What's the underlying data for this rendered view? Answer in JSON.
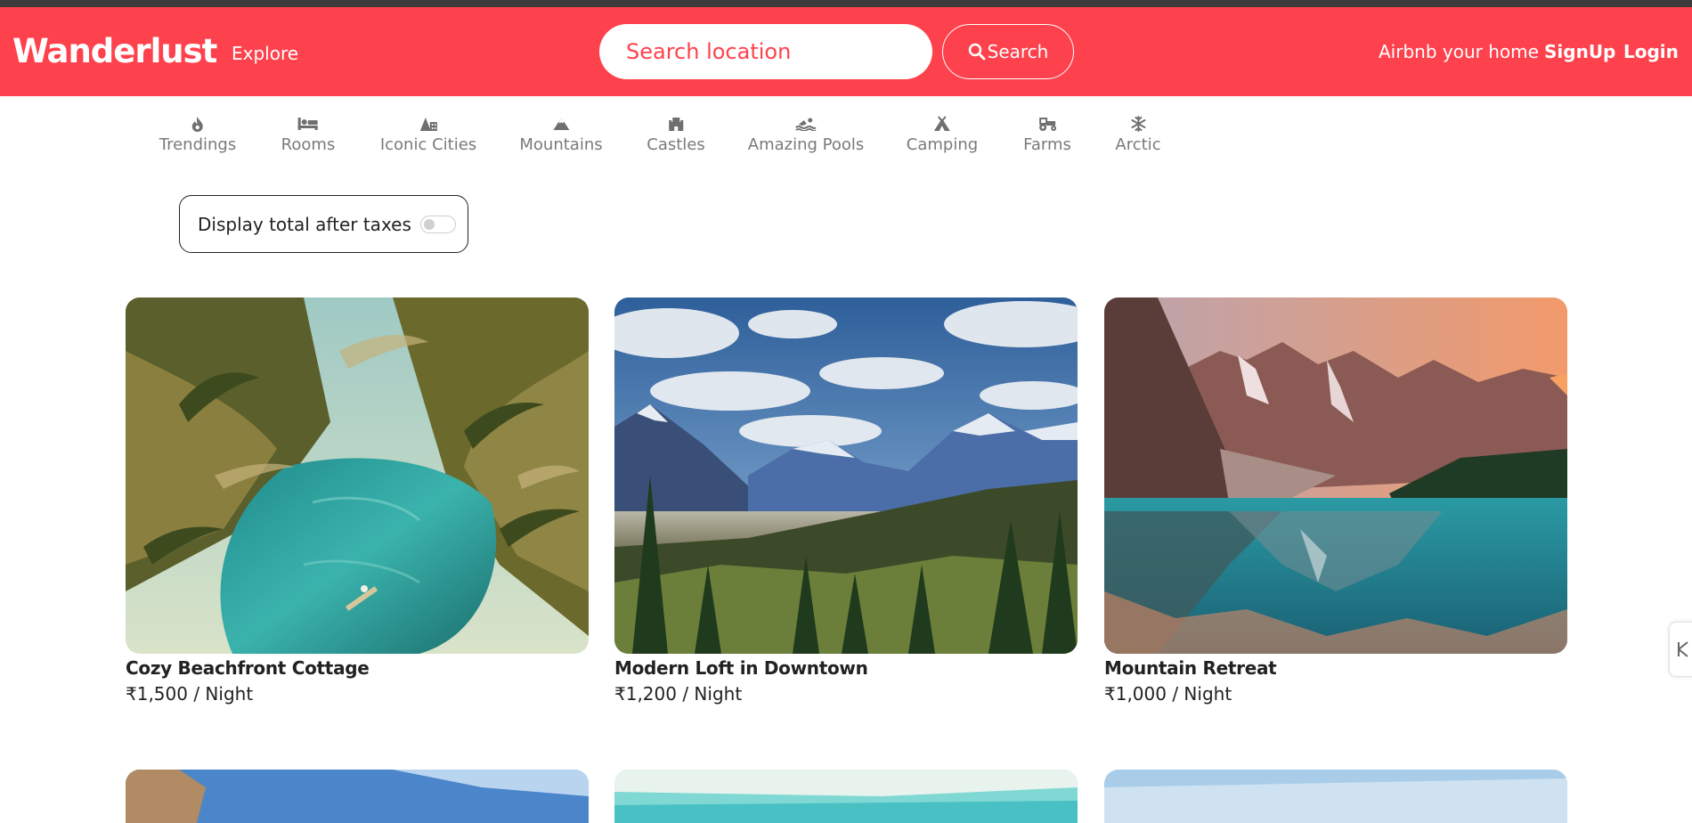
{
  "navbar": {
    "brand": "Wanderlust",
    "explore": "Explore",
    "search_placeholder": "Search location",
    "search_button": "Search",
    "host_link": "Airbnb your home",
    "signup": "SignUp",
    "login": "Login"
  },
  "filters": [
    {
      "label": "Trendings",
      "icon": "fire-icon"
    },
    {
      "label": "Rooms",
      "icon": "bed-icon"
    },
    {
      "label": "Iconic Cities",
      "icon": "city-icon"
    },
    {
      "label": "Mountains",
      "icon": "mountain-icon"
    },
    {
      "label": "Castles",
      "icon": "castle-icon"
    },
    {
      "label": "Amazing Pools",
      "icon": "swimmer-icon"
    },
    {
      "label": "Camping",
      "icon": "campground-icon"
    },
    {
      "label": "Farms",
      "icon": "tractor-icon"
    },
    {
      "label": "Arctic",
      "icon": "snowflake-icon"
    }
  ],
  "tax_toggle": {
    "label": "Display total after taxes",
    "checked": false
  },
  "listings": [
    {
      "title": "Cozy Beachfront Cottage",
      "price": "₹1,500 / Night",
      "scene": "tropical-lagoon"
    },
    {
      "title": "Modern Loft in Downtown",
      "price": "₹1,200 / Night",
      "scene": "mountain-valley"
    },
    {
      "title": "Mountain Retreat",
      "price": "₹1,000 / Night",
      "scene": "lake-reflection"
    }
  ],
  "colors": {
    "brand": "#fe424d",
    "text": "#222222",
    "muted": "#7a7a7a"
  }
}
